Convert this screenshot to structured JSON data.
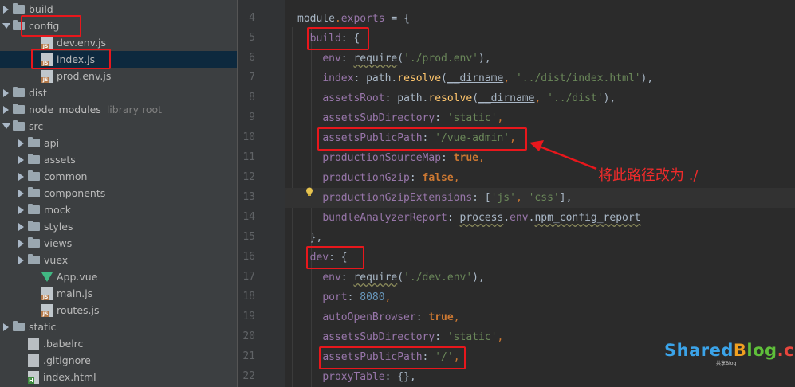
{
  "tree": {
    "rows": [
      {
        "label": "build",
        "type": "folder",
        "arrow": "right",
        "indent": 16
      },
      {
        "label": "config",
        "type": "folder",
        "arrow": "down",
        "indent": 16
      },
      {
        "label": "dev.env.js",
        "type": "js",
        "arrow": "none",
        "indent": 52
      },
      {
        "label": "index.js",
        "type": "js",
        "arrow": "none",
        "indent": 52
      },
      {
        "label": "prod.env.js",
        "type": "js",
        "arrow": "none",
        "indent": 52
      },
      {
        "label": "dist",
        "type": "folder",
        "arrow": "right",
        "indent": 16
      },
      {
        "label": "node_modules",
        "type": "folder",
        "arrow": "right",
        "indent": 16,
        "note": "library root"
      },
      {
        "label": "src",
        "type": "folder",
        "arrow": "down",
        "indent": 16
      },
      {
        "label": "api",
        "type": "folder",
        "arrow": "right",
        "indent": 35
      },
      {
        "label": "assets",
        "type": "folder",
        "arrow": "right",
        "indent": 35
      },
      {
        "label": "common",
        "type": "folder",
        "arrow": "right",
        "indent": 35
      },
      {
        "label": "components",
        "type": "folder",
        "arrow": "right",
        "indent": 35
      },
      {
        "label": "mock",
        "type": "folder",
        "arrow": "right",
        "indent": 35
      },
      {
        "label": "styles",
        "type": "folder",
        "arrow": "right",
        "indent": 35
      },
      {
        "label": "views",
        "type": "folder",
        "arrow": "right",
        "indent": 35
      },
      {
        "label": "vuex",
        "type": "folder",
        "arrow": "right",
        "indent": 35
      },
      {
        "label": "App.vue",
        "type": "vue",
        "arrow": "none",
        "indent": 52
      },
      {
        "label": "main.js",
        "type": "js",
        "arrow": "none",
        "indent": 52
      },
      {
        "label": "routes.js",
        "type": "js",
        "arrow": "none",
        "indent": 52
      },
      {
        "label": "static",
        "type": "folder",
        "arrow": "right",
        "indent": 16
      },
      {
        "label": ".babelrc",
        "type": "gen",
        "arrow": "none",
        "indent": 35
      },
      {
        "label": ".gitignore",
        "type": "gen",
        "arrow": "none",
        "indent": 35
      },
      {
        "label": "index.html",
        "type": "html",
        "arrow": "none",
        "indent": 35
      }
    ],
    "selected_index": 3
  },
  "editor": {
    "line_numbers": [
      "4",
      "5",
      "6",
      "7",
      "8",
      "9",
      "10",
      "11",
      "12",
      "13",
      "14",
      "15",
      "16",
      "17",
      "18",
      "19",
      "20",
      "21",
      "22"
    ],
    "current_line_index": 9,
    "lines": [
      [
        [
          "plain",
          "module"
        ],
        [
          "op",
          "."
        ],
        [
          "prop",
          "exports"
        ],
        [
          "plain",
          " = {"
        ]
      ],
      [
        [
          "plain",
          "  "
        ],
        [
          "prop",
          "build"
        ],
        [
          "plain",
          ": {"
        ]
      ],
      [
        [
          "plain",
          "    "
        ],
        [
          "prop",
          "env"
        ],
        [
          "plain",
          ": "
        ],
        [
          "wavy",
          "require"
        ],
        [
          "plain",
          "("
        ],
        [
          "str",
          "'./prod.env'"
        ],
        [
          "plain",
          "),"
        ]
      ],
      [
        [
          "plain",
          "    "
        ],
        [
          "prop",
          "index"
        ],
        [
          "plain",
          ": path."
        ],
        [
          "fn",
          "resolve"
        ],
        [
          "plain",
          "("
        ],
        [
          "strike",
          "__dirname"
        ],
        [
          "op",
          ", "
        ],
        [
          "str",
          "'../dist/index.html'"
        ],
        [
          "plain",
          "),"
        ]
      ],
      [
        [
          "plain",
          "    "
        ],
        [
          "prop",
          "assetsRoot"
        ],
        [
          "plain",
          ": path."
        ],
        [
          "fn",
          "resolve"
        ],
        [
          "plain",
          "("
        ],
        [
          "strike",
          "__dirname"
        ],
        [
          "op",
          ", "
        ],
        [
          "str",
          "'../dist'"
        ],
        [
          "plain",
          "),"
        ]
      ],
      [
        [
          "plain",
          "    "
        ],
        [
          "prop",
          "assetsSubDirectory"
        ],
        [
          "plain",
          ": "
        ],
        [
          "str",
          "'static'"
        ],
        [
          "op",
          ","
        ]
      ],
      [
        [
          "plain",
          "    "
        ],
        [
          "prop",
          "assetsPublicPath"
        ],
        [
          "plain",
          ": "
        ],
        [
          "str",
          "'/vue-admin'"
        ],
        [
          "op",
          ","
        ]
      ],
      [
        [
          "plain",
          "    "
        ],
        [
          "prop",
          "productionSourceMap"
        ],
        [
          "plain",
          ": "
        ],
        [
          "kw",
          "true"
        ],
        [
          "op",
          ","
        ]
      ],
      [
        [
          "plain",
          "    "
        ],
        [
          "prop",
          "productionGzip"
        ],
        [
          "plain",
          ": "
        ],
        [
          "kw",
          "false"
        ],
        [
          "op",
          ","
        ]
      ],
      [
        [
          "plain",
          "    "
        ],
        [
          "prop",
          "productionGzipExtensions"
        ],
        [
          "plain",
          ": ["
        ],
        [
          "str",
          "'js'"
        ],
        [
          "op",
          ", "
        ],
        [
          "str",
          "'css'"
        ],
        [
          "plain",
          "],"
        ]
      ],
      [
        [
          "plain",
          "    "
        ],
        [
          "prop",
          "bundleAnalyzerReport"
        ],
        [
          "plain",
          ": "
        ],
        [
          "wavy",
          "process"
        ],
        [
          "plain",
          "."
        ],
        [
          "prop",
          "env"
        ],
        [
          "plain",
          "."
        ],
        [
          "wavy",
          "npm_config_report"
        ]
      ],
      [
        [
          "plain",
          "  },"
        ]
      ],
      [
        [
          "plain",
          "  "
        ],
        [
          "prop",
          "dev"
        ],
        [
          "plain",
          ": {"
        ]
      ],
      [
        [
          "plain",
          "    "
        ],
        [
          "prop",
          "env"
        ],
        [
          "plain",
          ": "
        ],
        [
          "wavy",
          "require"
        ],
        [
          "plain",
          "("
        ],
        [
          "str",
          "'./dev.env'"
        ],
        [
          "plain",
          "),"
        ]
      ],
      [
        [
          "plain",
          "    "
        ],
        [
          "prop",
          "port"
        ],
        [
          "plain",
          ": "
        ],
        [
          "num",
          "8080"
        ],
        [
          "op",
          ","
        ]
      ],
      [
        [
          "plain",
          "    "
        ],
        [
          "prop",
          "autoOpenBrowser"
        ],
        [
          "plain",
          ": "
        ],
        [
          "kw",
          "true"
        ],
        [
          "op",
          ","
        ]
      ],
      [
        [
          "plain",
          "    "
        ],
        [
          "prop",
          "assetsSubDirectory"
        ],
        [
          "plain",
          ": "
        ],
        [
          "str",
          "'static'"
        ],
        [
          "op",
          ","
        ]
      ],
      [
        [
          "plain",
          "    "
        ],
        [
          "prop",
          "assetsPublicPath"
        ],
        [
          "plain",
          ": "
        ],
        [
          "str",
          "'/'"
        ],
        [
          "op",
          ","
        ]
      ],
      [
        [
          "plain",
          "    "
        ],
        [
          "prop",
          "proxyTable"
        ],
        [
          "plain",
          ": {},"
        ]
      ]
    ]
  },
  "annotation": {
    "text": "将此路径改为 ./",
    "color": "#ef2b2b"
  },
  "watermark": {
    "parts": [
      "Shared",
      "B",
      "log",
      ".cn"
    ],
    "sub": "共享Blog"
  },
  "colors": {
    "tree_bg": "#3c3f41",
    "editor_bg": "#2b2b2b",
    "highlight_red": "#e8171c"
  }
}
